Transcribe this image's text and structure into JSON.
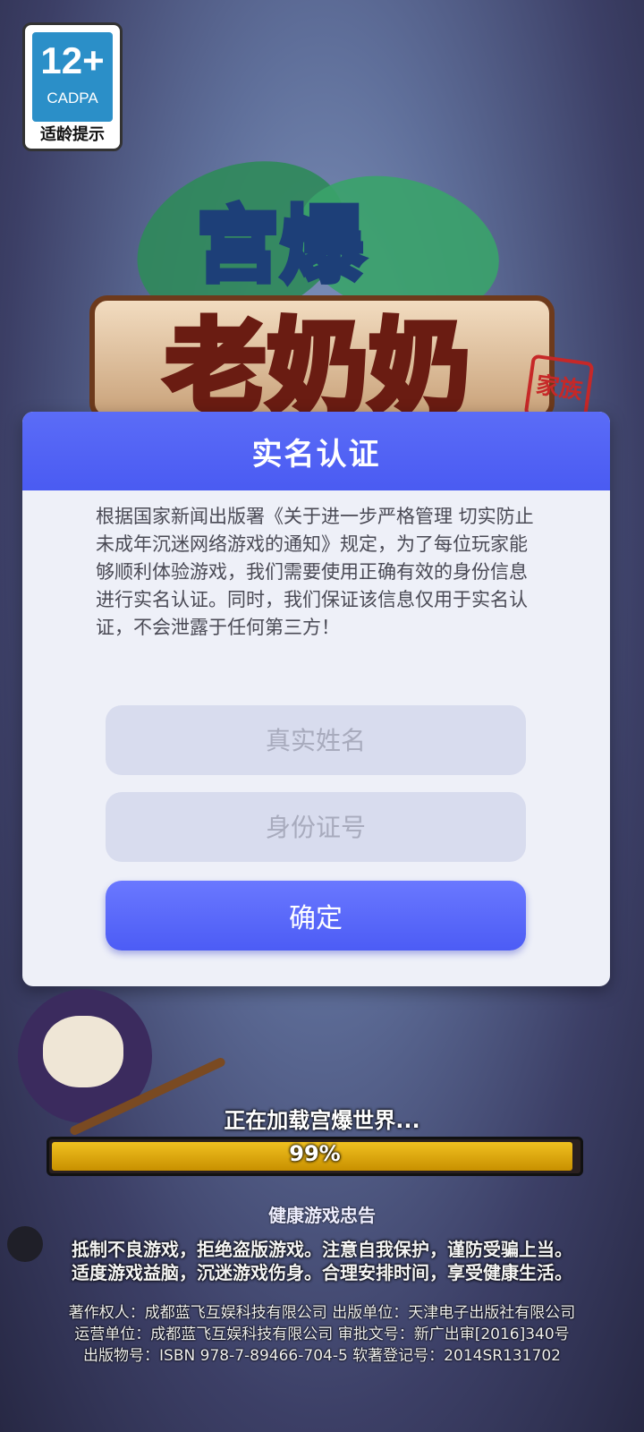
{
  "age_rating": {
    "number": "12+",
    "org": "CADPA",
    "label": "适龄提示"
  },
  "dialog": {
    "title": "实名认证",
    "notice": "根据国家新闻出版署《关于进一步严格管理 切实防止未成年沉迷网络游戏的通知》规定，为了每位玩家能够顺利体验游戏，我们需要使用正确有效的身份信息进行实名认证。同时，我们保证该信息仅用于实名认证，不会泄露于任何第三方！",
    "name_placeholder": "真实姓名",
    "id_placeholder": "身份证号",
    "confirm_label": "确定"
  },
  "loading": {
    "text": "正在加载宫爆世界...",
    "progress_fraction": 0.99,
    "progress_label": "99%"
  },
  "health_notice": {
    "title": "健康游戏忠告",
    "lines": [
      "抵制不良游戏，拒绝盗版游戏。注意自我保护，谨防受骗上当。",
      "适度游戏益脑，沉迷游戏伤身。合理安排时间，享受健康生活。"
    ]
  },
  "credits": [
    "著作权人：成都蓝飞互娱科技有限公司  出版单位：天津电子出版社有限公司",
    "运营单位：成都蓝飞互娱科技有限公司  审批文号：新广出审[2016]340号",
    "出版物号：ISBN 978-7-89466-704-5  软著登记号：2014SR131702"
  ],
  "colors": {
    "dialog_header": "#4a5bf2",
    "progress_fill": "#e0b010",
    "input_bg": "#d8dcee"
  }
}
